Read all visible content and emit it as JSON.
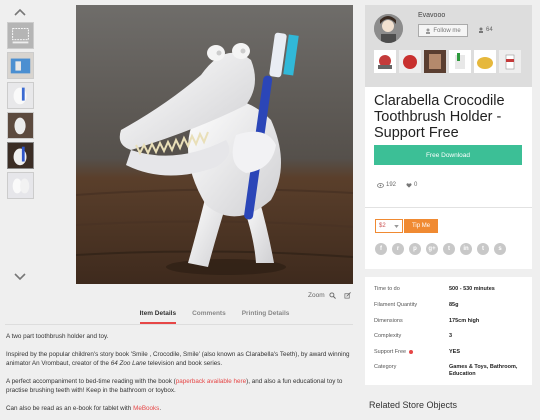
{
  "thumbnails": {
    "count": 6,
    "icon_up": "chevron-up-icon",
    "icon_down": "chevron-down-icon"
  },
  "media": {
    "zoom_label": "Zoom"
  },
  "tabs": [
    {
      "label": "Item Details",
      "active": true
    },
    {
      "label": "Comments",
      "active": false
    },
    {
      "label": "Printing Details",
      "active": false
    }
  ],
  "description": {
    "p1": "A two part toothbrush holder and toy.",
    "p2_a": "Inspired by the popular children's story book 'Smile , Crocodile, Smile' (also known as Clarabella's Teeth), by award winning animator An Vrombaut, creator of the ",
    "p2_italic": "64 Zoo Lane",
    "p2_b": " television and book series.",
    "p3_a": "A perfect accompaniment to bed-time reading with the book (",
    "p3_link": "paperback available here",
    "p3_b": "), and also a fun educational toy to practise brushing teeth with! Keep in the bathroom or toybox.",
    "p4_a": "Can also be read as an e-book for tablet with ",
    "p4_link": "MeBooks",
    "p4_b": "."
  },
  "author": {
    "name": "Evavooo",
    "follow_label": "Follow me",
    "followers": "64"
  },
  "item": {
    "title": "Clarabella Crocodile Toothbrush Holder - Support Free",
    "download_label": "Free Download",
    "views": "192",
    "likes": "0"
  },
  "tip": {
    "amount": "$2",
    "button_label": "Tip Me"
  },
  "share_icons": [
    "facebook-icon",
    "reddit-icon",
    "pinterest-icon",
    "google-plus-icon",
    "twitter-icon",
    "linkedin-icon",
    "tumblr-icon",
    "stumbleupon-icon"
  ],
  "share_glyphs": [
    "f",
    "r",
    "p",
    "g+",
    "t",
    "in",
    "t",
    "s"
  ],
  "specs": [
    {
      "key": "Time to do",
      "value": "500 - 530 minutes"
    },
    {
      "key": "Filament Quantity",
      "value": "85g"
    },
    {
      "key": "Dimensions",
      "value": "175cm high"
    },
    {
      "key": "Complexity",
      "value": "3"
    },
    {
      "key": "Support Free",
      "value": "YES"
    },
    {
      "key": "Category",
      "value": "Games & Toys, Bathroom, Education"
    }
  ],
  "related_title": "Related Store Objects",
  "colors": {
    "accent": "#e64646",
    "download": "#3cbf96",
    "tip": "#f08a32"
  }
}
